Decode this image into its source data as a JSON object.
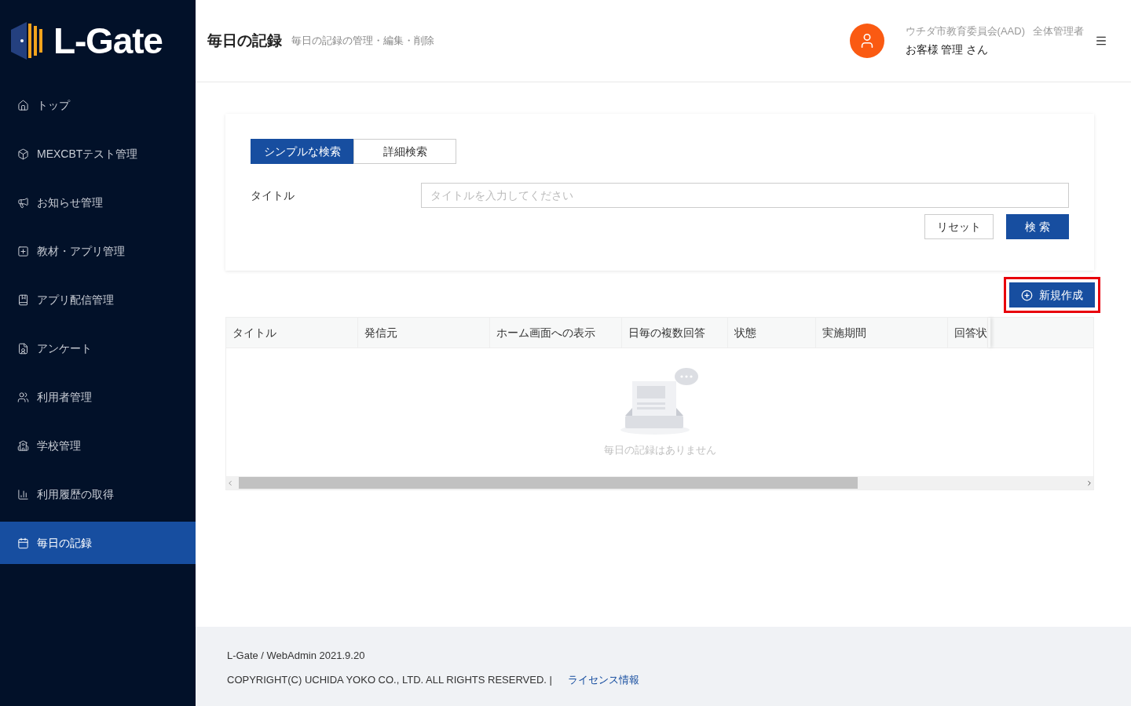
{
  "sidebar": {
    "logo_text": "L-Gate",
    "items": [
      {
        "label": "トップ",
        "selected": false
      },
      {
        "label": "MEXCBTテスト管理",
        "selected": false
      },
      {
        "label": "お知らせ管理",
        "selected": false
      },
      {
        "label": "教材・アプリ管理",
        "selected": false
      },
      {
        "label": "アプリ配信管理",
        "selected": false
      },
      {
        "label": "アンケート",
        "selected": false
      },
      {
        "label": "利用者管理",
        "selected": false
      },
      {
        "label": "学校管理",
        "selected": false
      },
      {
        "label": "利用履歴の取得",
        "selected": false
      },
      {
        "label": "毎日の記録",
        "selected": true
      }
    ]
  },
  "header": {
    "title": "毎日の記録",
    "subtitle": "毎日の記録の管理・編集・削除",
    "organization": "ウチダ市教育委員会(AAD)",
    "role": "全体管理者",
    "user": "お客様 管理 さん"
  },
  "search": {
    "tabs": [
      {
        "label": "シンプルな検索",
        "selected": true
      },
      {
        "label": "詳細検索",
        "selected": false
      }
    ],
    "field_label": "タイトル",
    "placeholder": "タイトルを入力してください",
    "reset": "リセット",
    "submit": "検 索"
  },
  "create_button": {
    "label": "新規作成",
    "highlighted": true
  },
  "table": {
    "columns": [
      "タイトル",
      "発信元",
      "ホーム画面への表示",
      "日毎の複数回答",
      "状態",
      "実施期間",
      "回答状"
    ],
    "empty_text": "毎日の記録はありません"
  },
  "footer": {
    "version": "L-Gate / WebAdmin 2021.9.20",
    "copyright": "COPYRIGHT(C) UCHIDA YOKO CO., LTD. ALL RIGHTS RESERVED. |",
    "link": "ライセンス情報"
  }
}
